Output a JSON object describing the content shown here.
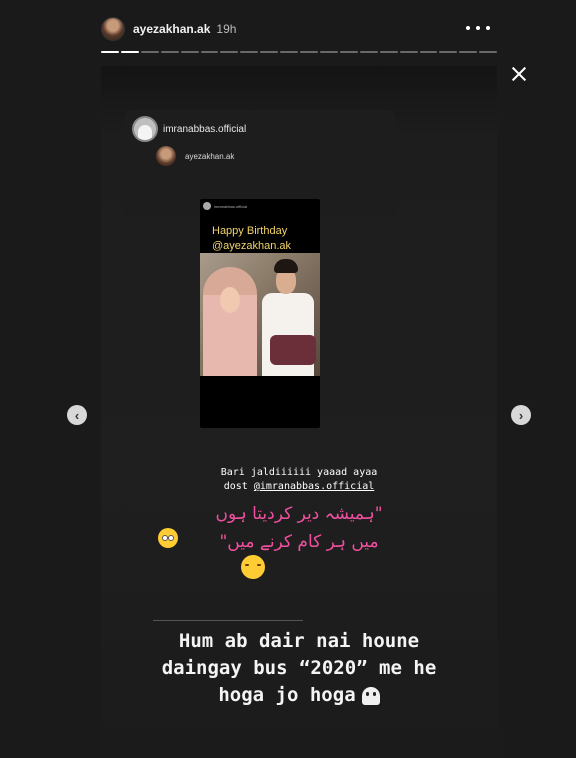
{
  "header": {
    "username": "ayezakhan.ak",
    "time": "19h"
  },
  "progress": {
    "segments": 20,
    "viewed": 2
  },
  "repost": {
    "author": "imranabbas.official",
    "mention": "ayezakhan.ak"
  },
  "card": {
    "user": "imranabbas.official",
    "title_line1": "Happy Birthday",
    "title_line2": "@ayezakhan.ak"
  },
  "caption": {
    "line1": "Bari jaldiiiiii yaaad ayaa",
    "line2_prefix": "dost ",
    "line2_mention": "@imranabbas.official"
  },
  "urdu": {
    "line1": "\"ہمیشہ دیر کردیتا ہوں",
    "line2": "میں ہر کام کرنے میں\""
  },
  "bottom_text": {
    "line1": "Hum ab dair nai houne",
    "line2": "daingay bus “2020” me he",
    "line3": "hoga jo hoga"
  },
  "icons": {
    "more": "more-horizontal-icon",
    "close": "close-icon",
    "prev": "chevron-left-icon",
    "next": "chevron-right-icon"
  },
  "nav": {
    "prev_glyph": "‹",
    "next_glyph": "›"
  },
  "colors": {
    "background": "#1a1a1a",
    "urdu_text": "#f04fa0",
    "card_title": "#f2d46a"
  }
}
